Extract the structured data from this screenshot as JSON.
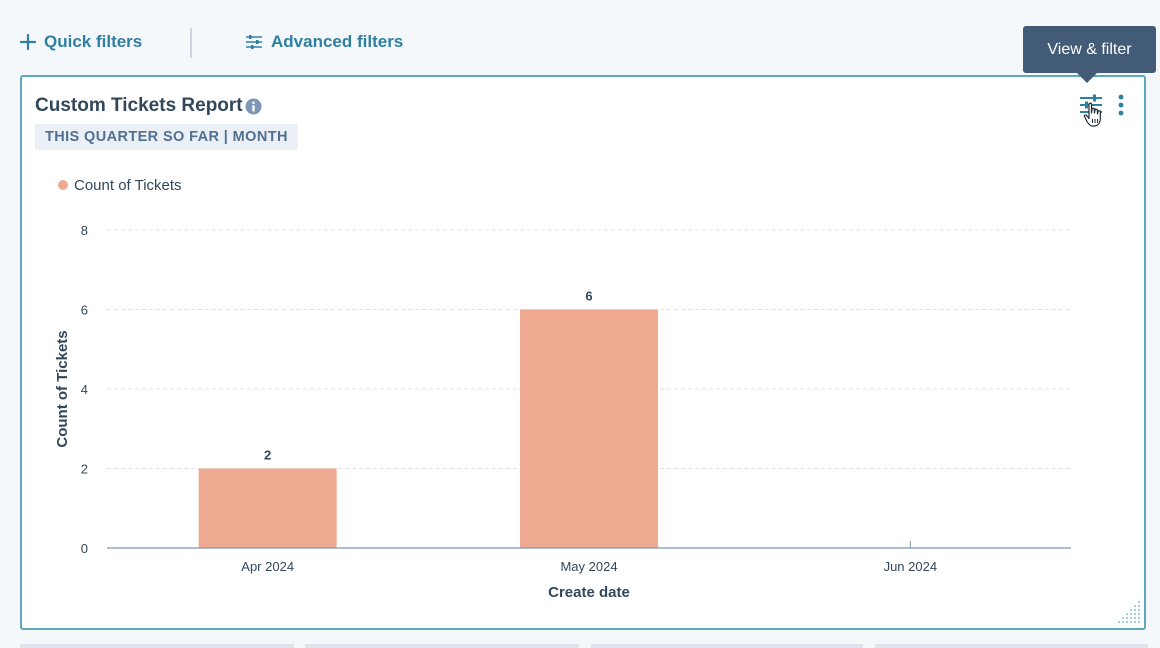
{
  "filters": {
    "quick_label": "Quick filters",
    "advanced_label": "Advanced filters"
  },
  "report": {
    "title": "Custom Tickets Report",
    "date_range": "THIS QUARTER SO FAR | MONTH"
  },
  "tooltip": {
    "text": "View & filter"
  },
  "colors": {
    "bar": "#f0a991",
    "accent": "#2f7fa0",
    "tooltip_bg": "#425b76",
    "card_border": "#5fa8b9"
  },
  "icons": {
    "quick": "plus-icon",
    "advanced": "sliders-icon",
    "view_filter": "sliders-icon",
    "more": "vertical-dots-icon",
    "info": "info-icon",
    "cursor": "hand-pointer-icon",
    "resize": "resize-handle-icon"
  },
  "chart_data": {
    "type": "bar",
    "categories": [
      "Apr 2024",
      "May 2024",
      "Jun 2024"
    ],
    "series": [
      {
        "name": "Count of Tickets",
        "values": [
          2,
          6,
          0
        ]
      }
    ],
    "data_labels": [
      "2",
      "6",
      ""
    ],
    "xlabel": "Create date",
    "ylabel": "Count of Tickets",
    "ylim": [
      0,
      8
    ],
    "yticks": [
      0,
      2,
      4,
      6,
      8
    ],
    "grid": true,
    "legend": "top-left"
  }
}
